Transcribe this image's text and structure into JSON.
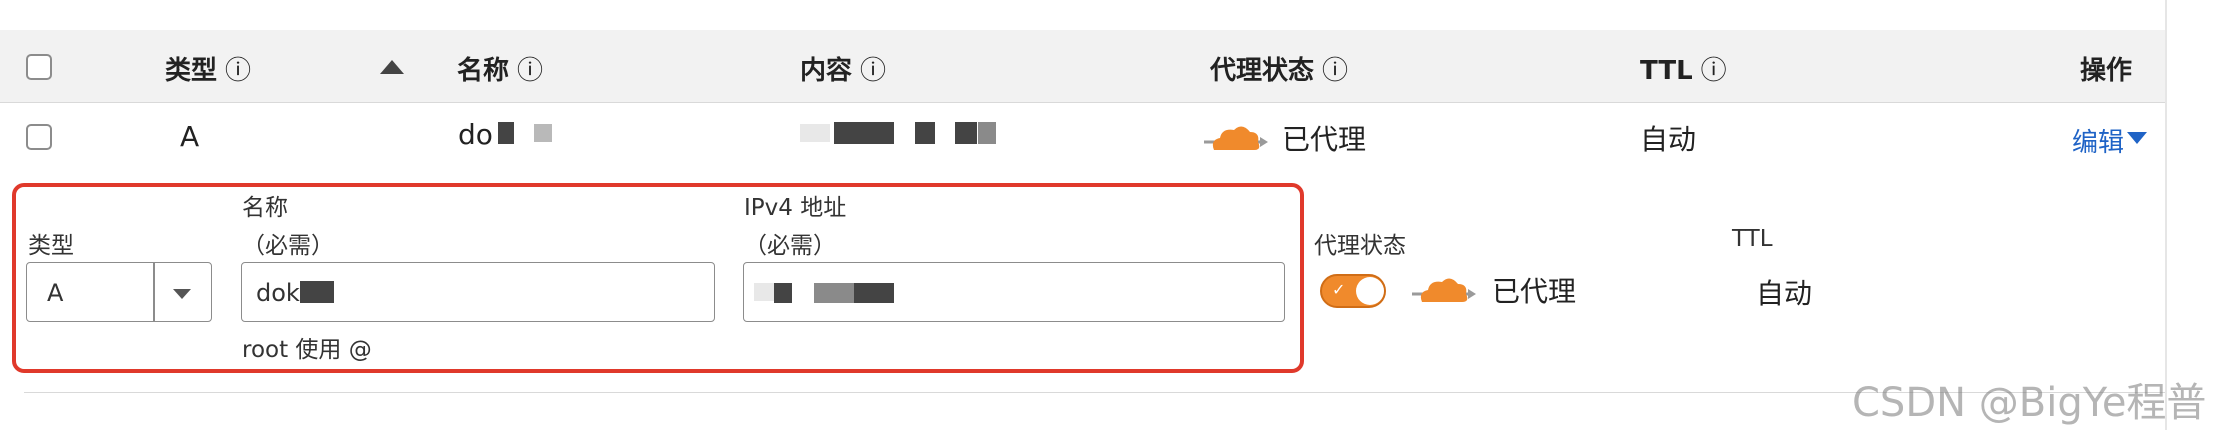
{
  "table": {
    "headers": {
      "type": "类型",
      "name": "名称",
      "content": "内容",
      "proxy_status": "代理状态",
      "ttl": "TTL",
      "actions": "操作"
    },
    "info_icon": "ⓘ",
    "row": {
      "type": "A",
      "name_prefix": "do",
      "proxy_status": "已代理",
      "ttl": "自动",
      "edit_label": "编辑"
    }
  },
  "edit_form": {
    "type_label": "类型",
    "type_value": "A",
    "name_label": "名称",
    "name_required": "（必需）",
    "name_value": "dok",
    "name_hint": "root 使用 @",
    "ipv4_label": "IPv4 地址",
    "ipv4_required": "（必需）",
    "proxy_label": "代理状态",
    "proxy_value": "已代理",
    "ttl_label": "TTL",
    "ttl_value": "自动"
  },
  "watermark": "CSDN @BigYe程普",
  "colors": {
    "accent_orange": "#f08a2c",
    "link_blue": "#1f63c6",
    "highlight_red": "#e0392b"
  }
}
